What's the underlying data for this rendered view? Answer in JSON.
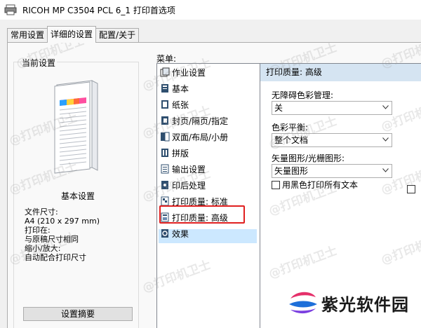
{
  "window": {
    "title": "RICOH MP C3504 PCL 6_1 打印首选项"
  },
  "tabs": [
    {
      "label": "常用设置",
      "active": false
    },
    {
      "label": "详细的设置",
      "active": true
    },
    {
      "label": "配置/关于",
      "active": false
    }
  ],
  "left": {
    "group_title": "当前设置",
    "basic_settings": "基本设置",
    "file_size_label": "文件尺寸:",
    "file_size_value": "A4 (210 x 297 mm)",
    "print_on_label": "打印在:",
    "print_on_value": "与原稿尺寸相同",
    "scale_label": "缩小/放大:",
    "scale_value": "自动配合打印尺寸",
    "summary_button": "设置摘要"
  },
  "menu": {
    "label": "菜单:",
    "items": [
      {
        "label": "作业设置",
        "icon": "job-settings-icon"
      },
      {
        "label": "基本",
        "icon": "basic-icon"
      },
      {
        "label": "纸张",
        "icon": "paper-icon"
      },
      {
        "label": "封页/隔页/指定",
        "icon": "cover-icon"
      },
      {
        "label": "双面/布局/小册",
        "icon": "duplex-icon"
      },
      {
        "label": "拼版",
        "icon": "imposition-icon"
      },
      {
        "label": "输出设置",
        "icon": "output-icon"
      },
      {
        "label": "印后处理",
        "icon": "finishing-icon"
      },
      {
        "label": "打印质量: 标准",
        "icon": "quality-standard-icon"
      },
      {
        "label": "打印质量: 高级",
        "icon": "quality-advanced-icon",
        "selected": true
      },
      {
        "label": "效果",
        "icon": "effects-icon"
      }
    ]
  },
  "panel": {
    "header": "打印质量: 高级",
    "color_mgmt_label": "无障碍色彩管理:",
    "color_mgmt_value": "关",
    "color_balance_label": "色彩平衡:",
    "color_balance_value": "整个文档",
    "vector_label": "矢量图形/光栅图形:",
    "vector_value": "矢量图形",
    "black_text_label": "用黑色打印所有文本"
  },
  "watermark_text": "@打印机卫士",
  "brand": {
    "name": "紫光软件园"
  },
  "colors": {
    "selection": "#cce8ff",
    "highlight_box": "#e02020",
    "panel_header": "#d5e4f2"
  }
}
